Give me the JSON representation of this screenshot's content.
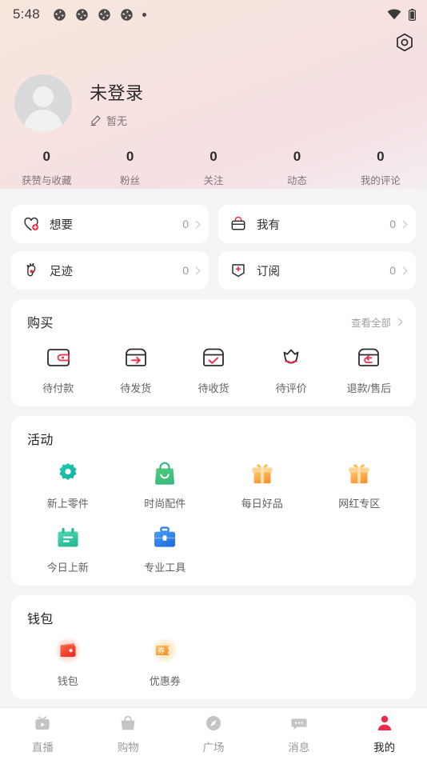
{
  "status_bar": {
    "time": "5:48",
    "left_icons": [
      "pinwheel-icon",
      "pinwheel-icon",
      "pinwheel-icon",
      "pinwheel-icon",
      "dot-icon"
    ],
    "right_icons": [
      "wifi-icon",
      "battery-icon"
    ]
  },
  "header": {
    "settings_icon": "settings-nut-icon",
    "nickname": "未登录",
    "signature": "暂无",
    "edit_icon": "pencil-edit-icon",
    "avatar": "default-avatar-placeholder"
  },
  "stats": [
    {
      "value": "0",
      "label": "获赞与收藏"
    },
    {
      "value": "0",
      "label": "粉丝"
    },
    {
      "value": "0",
      "label": "关注"
    },
    {
      "value": "0",
      "label": "动态"
    },
    {
      "value": "0",
      "label": "我的评论"
    }
  ],
  "quick_links": [
    {
      "label": "想要",
      "count": "0",
      "icon": "heart-plus-icon"
    },
    {
      "label": "我有",
      "count": "0",
      "icon": "basket-icon"
    },
    {
      "label": "足迹",
      "count": "0",
      "icon": "footprint-icon"
    },
    {
      "label": "订阅",
      "count": "0",
      "icon": "bookmark-plus-icon"
    }
  ],
  "purchase": {
    "title": "购买",
    "view_all": "查看全部",
    "items": [
      {
        "label": "待付款",
        "icon": "wallet-outline-icon"
      },
      {
        "label": "待发货",
        "icon": "box-arrow-icon"
      },
      {
        "label": "待收货",
        "icon": "box-check-icon"
      },
      {
        "label": "待评价",
        "icon": "flower-icon"
      },
      {
        "label": "退款/售后",
        "icon": "box-return-icon"
      }
    ]
  },
  "activity": {
    "title": "活动",
    "items": [
      {
        "label": "新上零件",
        "icon": "gear-icon",
        "color": "#1fc0ac"
      },
      {
        "label": "时尚配件",
        "icon": "shopping-bag-icon",
        "color": "#46c06a"
      },
      {
        "label": "每日好品",
        "icon": "gift-box-icon",
        "color": "#f8a23c"
      },
      {
        "label": "网红专区",
        "icon": "gift-box-icon",
        "color": "#f8a23c"
      },
      {
        "label": "今日上新",
        "icon": "calendar-icon",
        "color": "#2cc9a0"
      },
      {
        "label": "专业工具",
        "icon": "briefcase-icon",
        "color": "#2f80ed"
      }
    ]
  },
  "wallet": {
    "title": "钱包",
    "items": [
      {
        "label": "钱包",
        "icon": "wallet-filled-icon",
        "color": "#f2462f"
      },
      {
        "label": "优惠券",
        "icon": "coupon-icon",
        "color": "#f7a32a",
        "glyph_text": "券"
      }
    ]
  },
  "tabbar": {
    "active_color": "#ef2a4a",
    "inactive_color": "#c4c4c4",
    "items": [
      {
        "label": "直播",
        "icon": "tv-play-icon",
        "active": false
      },
      {
        "label": "购物",
        "icon": "shopping-basket-icon",
        "active": false
      },
      {
        "label": "广场",
        "icon": "compass-icon",
        "active": false
      },
      {
        "label": "消息",
        "icon": "chat-bubble-icon",
        "active": false
      },
      {
        "label": "我的",
        "icon": "person-icon",
        "active": true
      }
    ]
  },
  "theme": {
    "accent": "#ef2a4a",
    "header_gradient_start": "#f6e7dd",
    "header_gradient_end": "#f3eef0"
  }
}
